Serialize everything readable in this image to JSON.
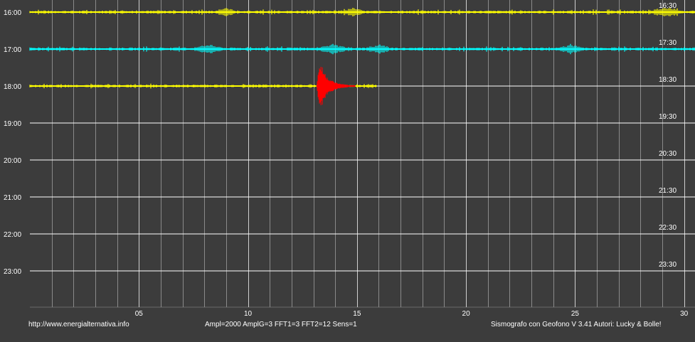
{
  "chart_data": {
    "type": "line",
    "title": "",
    "xlabel": "",
    "ylabel": "",
    "x_range": [
      0,
      30.5
    ],
    "x_ticks": [
      "05",
      "10",
      "15",
      "20",
      "25",
      "30"
    ],
    "x_tick_values": [
      5,
      10,
      15,
      20,
      25,
      30
    ],
    "rows_left": [
      "16:00",
      "17:00",
      "18:00",
      "19:00",
      "20:00",
      "21:00",
      "22:00",
      "23:00"
    ],
    "rows_right": [
      "16:30",
      "17:30",
      "18:30",
      "19:30",
      "20:30",
      "21:30",
      "22:30",
      "23:30"
    ],
    "grid": true,
    "colors": {
      "background": "#3c3c3c",
      "grid": "#8a8a8a",
      "row_line": "#ffffff",
      "text": "#ffffff"
    },
    "series": [
      {
        "row": "16:00",
        "color": "#ffff00",
        "x_start": 0,
        "x_end": 30.5,
        "bursts": [
          [
            9,
            0.5
          ],
          [
            14.8,
            0.6
          ],
          [
            29.2,
            0.9
          ]
        ]
      },
      {
        "row": "17:00",
        "color": "#00ffff",
        "x_start": 0,
        "x_end": 30.5,
        "bursts": [
          [
            8.2,
            0.8
          ],
          [
            13.9,
            0.9
          ],
          [
            16.0,
            0.6
          ],
          [
            24.8,
            0.6
          ]
        ]
      },
      {
        "row": "18:00",
        "color": "#ffff00",
        "x_start": 0,
        "x_end": 15.9,
        "bursts": []
      }
    ],
    "event": {
      "row": "18:00",
      "color": "#ff0000",
      "x_start": 13.15,
      "x_end": 14.6
    }
  },
  "footer": {
    "url": "http://www.energialternativa.info",
    "params": "Ampl=2000 AmplG=3 FFT1=3 FFT2=12 Sens=1",
    "credits": "Sismografo con Geofono V 3.41  Autori: Lucky & Bolle!"
  }
}
